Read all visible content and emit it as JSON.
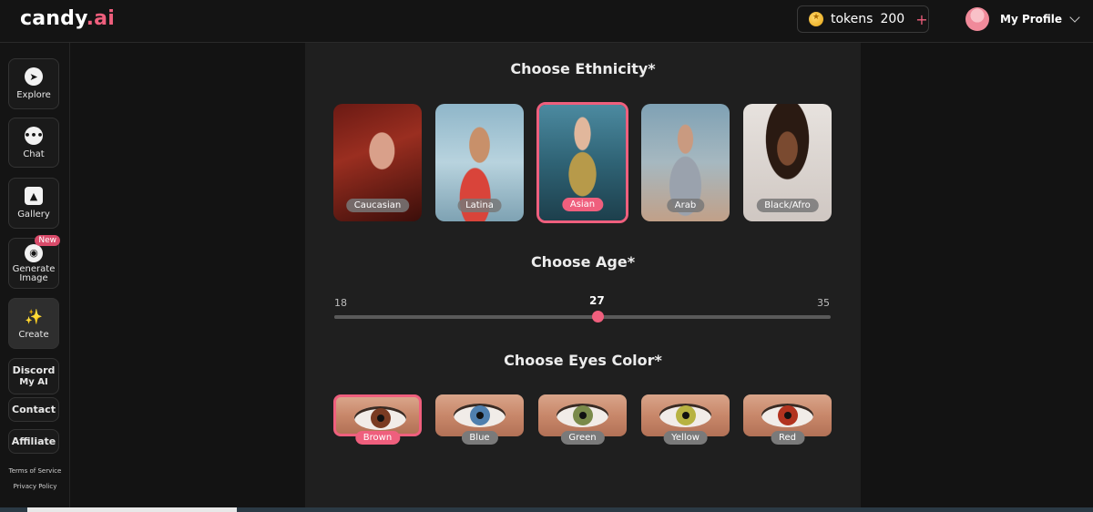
{
  "header": {
    "logo_main": "candy",
    "logo_accent": ".ai",
    "tokens_label": "tokens",
    "tokens_count": "200",
    "tokens_plus": "+",
    "profile_label": "My Profile"
  },
  "sidebar": {
    "items": [
      {
        "label": "Explore",
        "icon": "compass-icon"
      },
      {
        "label": "Chat",
        "icon": "chat-bubble-icon"
      },
      {
        "label": "Gallery",
        "icon": "image-icon"
      },
      {
        "label": "Generate Image",
        "icon": "camera-icon",
        "badge": "New"
      },
      {
        "label": "Create",
        "icon": "magic-wand-icon"
      },
      {
        "label": "Discord",
        "sub": "My AI"
      },
      {
        "label": "Contact"
      },
      {
        "label": "Affiliate"
      }
    ],
    "terms": "Terms of Service",
    "privacy": "Privacy Policy"
  },
  "ethnicity": {
    "title": "Choose Ethnicity*",
    "options": [
      "Caucasian",
      "Latina",
      "Asian",
      "Arab",
      "Black/Afro"
    ],
    "selected": "Asian"
  },
  "age": {
    "title": "Choose Age*",
    "min": "18",
    "max": "35",
    "value": "27",
    "fraction": 0.53
  },
  "eyes": {
    "title": "Choose Eyes Color*",
    "options": [
      "Brown",
      "Blue",
      "Green",
      "Yellow",
      "Red"
    ],
    "selected": "Brown",
    "iris_colors": [
      "#7a3b22",
      "#4f7fae",
      "#7a8a4a",
      "#b7b241",
      "#b2331f"
    ]
  },
  "colors": {
    "accent": "#ef5f7d"
  }
}
